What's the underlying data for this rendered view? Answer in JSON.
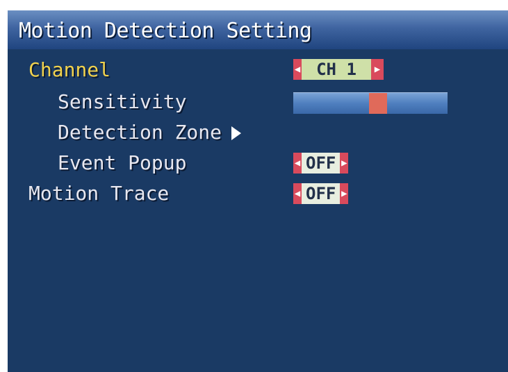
{
  "title": "Motion Detection Setting",
  "menu": {
    "channel": {
      "label": "Channel",
      "value": "CH 1"
    },
    "sensitivity": {
      "label": "Sensitivity",
      "level": 0.55
    },
    "detection_zone": {
      "label": "Detection Zone"
    },
    "event_popup": {
      "label": "Event Popup",
      "value": "OFF"
    },
    "motion_trace": {
      "label": "Motion Trace",
      "value": "OFF"
    }
  },
  "colors": {
    "background": "#1a3a64",
    "highlight": "#f1d24d",
    "spinner_arrow": "#d94a5c",
    "slider_thumb": "#e06a5a"
  }
}
